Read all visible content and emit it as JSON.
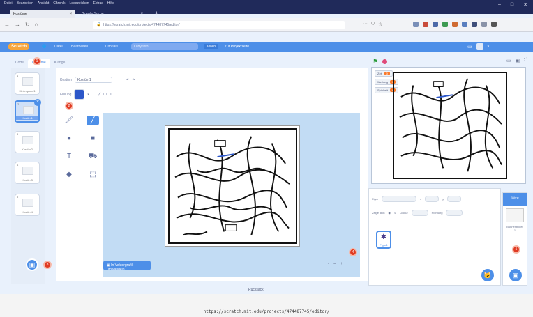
{
  "browser": {
    "menus": [
      "Datei",
      "Bearbeiten",
      "Ansicht",
      "Chronik",
      "Lesezeichen",
      "Extras",
      "Hilfe"
    ],
    "tabs": [
      {
        "label": "Kostüme",
        "active": true
      },
      {
        "label": "Google Suche",
        "active": false
      }
    ],
    "url": "https://scratch.mit.edu/projects/474487745/editor/",
    "nav_icons": [
      "back-icon",
      "forward-icon",
      "reload-icon",
      "home-icon"
    ]
  },
  "scratch_bar": {
    "logo": "Scratch",
    "items": [
      "Datei",
      "Bearbeiten",
      "Tutorials"
    ],
    "project_title": "Labyrinth",
    "share": "Teilen",
    "see_project": "Zur Projektseite"
  },
  "editor_tabs": [
    "Code",
    "Kostüme",
    "Klänge"
  ],
  "costumes": [
    {
      "num": "1",
      "name": "Hintergrund1",
      "size": "2 x 2"
    },
    {
      "num": "2",
      "name": "Kostüm1",
      "size": "480 x 360",
      "selected": true
    },
    {
      "num": "3",
      "name": "Kostüm2",
      "size": "480 x 360"
    },
    {
      "num": "4",
      "name": "Kostüm3",
      "size": "480 x 360"
    },
    {
      "num": "5",
      "name": "Kostüm4",
      "size": "480 x 360"
    }
  ],
  "paint": {
    "costume_label": "Kostüm",
    "costume_name": "Kostüm1",
    "fill_label": "Füllung",
    "outline_value": "10",
    "convert_button": "In Vektorgrafik umwandeln",
    "zoom": [
      "-",
      "=",
      "+"
    ]
  },
  "monitors": [
    {
      "name": "Zeit",
      "value": "0"
    },
    {
      "name": "Wertung",
      "value": "0"
    },
    {
      "name": "Spielzeit",
      "value": "0"
    }
  ],
  "sprite_pane": {
    "sprite_label": "Figur",
    "x_label": "x",
    "y_label": "y",
    "show_label": "Zeige dich",
    "size_label": "Größe",
    "direction_label": "Richtung",
    "sprite_name": "Figur1"
  },
  "stage_pane": {
    "title": "Bühne",
    "backdrops_label": "Bühnenbilder",
    "count": "1"
  },
  "annotations": [
    "1",
    "2",
    "3",
    "4",
    "5",
    "6"
  ],
  "tray_label": "Rucksack",
  "caption": "https://scratch.mit.edu/projects/474487745/editor/",
  "colors": {
    "accent": "#4d8fe8",
    "orange": "#f7a53b",
    "annotation": "#e03a22"
  }
}
